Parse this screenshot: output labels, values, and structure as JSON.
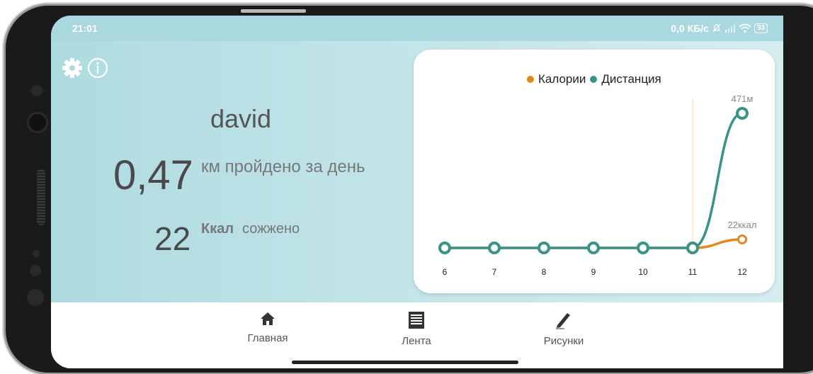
{
  "status_bar": {
    "time": "21:01",
    "network_speed": "0,0 КБ/с",
    "battery": "93"
  },
  "header_icons": {
    "settings": "gear-icon",
    "info": "info-icon"
  },
  "profile": {
    "username": "david",
    "distance_value": "0,47",
    "distance_label": "км пройдено за день",
    "kcal_value": "22",
    "kcal_unit": "Ккал",
    "kcal_label": "сожжено"
  },
  "chart_data": {
    "type": "line",
    "title": "",
    "xlabel": "",
    "ylabel": "",
    "categories": [
      "6",
      "7",
      "8",
      "9",
      "10",
      "11",
      "12"
    ],
    "series": [
      {
        "name": "Калории",
        "color": "#e08a1e",
        "values": [
          0,
          0,
          0,
          0,
          0,
          0,
          22
        ],
        "end_label": "22ккал"
      },
      {
        "name": "Дистанция",
        "color": "#3a9389",
        "values": [
          0,
          0,
          0,
          0,
          0,
          0,
          471
        ],
        "end_label": "471м"
      }
    ],
    "legend_position": "top-center",
    "grid": false
  },
  "nav": {
    "items": [
      {
        "label": "Главная",
        "icon": "home-icon"
      },
      {
        "label": "Лента",
        "icon": "feed-icon"
      },
      {
        "label": "Рисунки",
        "icon": "pencil-icon"
      }
    ]
  }
}
